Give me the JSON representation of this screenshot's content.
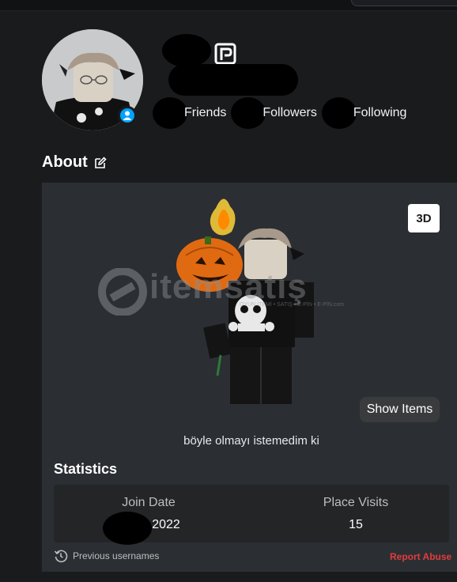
{
  "header": {
    "stats": [
      {
        "label": "Friends"
      },
      {
        "label": "Followers"
      },
      {
        "label": "Following"
      }
    ]
  },
  "about": {
    "title": "About",
    "view_mode_button": "3D",
    "watermark_text": "itemsatış",
    "watermark_subtext": "OYUN İTEMİ • SATIŞ • E-PİN • E-PİN.com",
    "show_items_label": "Show Items",
    "bio": "böyle olmayı istemedim ki"
  },
  "statistics": {
    "title": "Statistics",
    "join_date_label": "Join Date",
    "join_date_value": "2022",
    "place_visits_label": "Place Visits",
    "place_visits_value": "15"
  },
  "footer": {
    "previous_usernames": "Previous usernames",
    "report_abuse": "Report Abuse"
  },
  "colors": {
    "background": "#191b1d",
    "panel": "#2b2e33",
    "online": "#00a2ff",
    "report": "#e03c3c"
  }
}
